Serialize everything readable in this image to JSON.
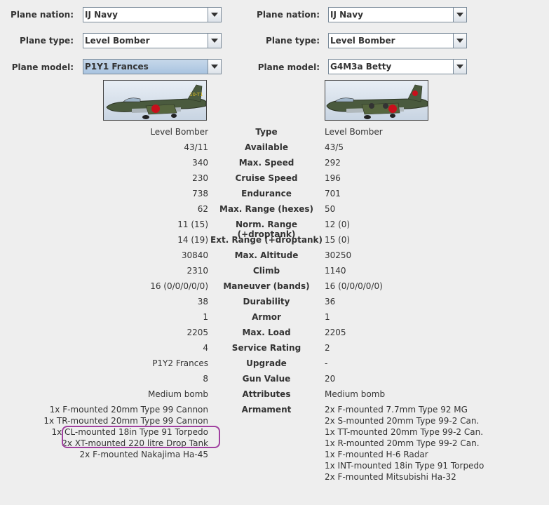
{
  "selectors": {
    "nation_label": "Plane nation:",
    "type_label": "Plane type:",
    "model_label": "Plane model:",
    "left": {
      "nation": "IJ Navy",
      "type": "Level Bomber",
      "model": "P1Y1 Frances"
    },
    "right": {
      "nation": "IJ Navy",
      "type": "Level Bomber",
      "model": "G4M3a Betty"
    }
  },
  "images": {
    "left": {
      "icon": "plane-p1y1-frances-image",
      "marking": "10-T1"
    },
    "right": {
      "icon": "plane-g4m3a-betty-image",
      "marking": ""
    }
  },
  "stats": [
    {
      "left": "Level Bomber",
      "label": "Type",
      "right": "Level Bomber"
    },
    {
      "left": "43/11",
      "label": "Available",
      "right": "43/5"
    },
    {
      "left": "340",
      "label": "Max. Speed",
      "right": "292"
    },
    {
      "left": "230",
      "label": "Cruise Speed",
      "right": "196"
    },
    {
      "left": "738",
      "label": "Endurance",
      "right": "701"
    },
    {
      "left": "62",
      "label": "Max. Range (hexes)",
      "right": "50"
    },
    {
      "left": "11 (15)",
      "label": "Norm. Range (+droptank)",
      "right": "12 (0)"
    },
    {
      "left": "14 (19)",
      "label": "Ext. Range (+droptank)",
      "right": "15 (0)"
    },
    {
      "left": "30840",
      "label": "Max. Altitude",
      "right": "30250"
    },
    {
      "left": "2310",
      "label": "Climb",
      "right": "1140"
    },
    {
      "left": "16 (0/0/0/0/0)",
      "label": "Maneuver (bands)",
      "right": "16 (0/0/0/0/0)"
    },
    {
      "left": "38",
      "label": "Durability",
      "right": "36"
    },
    {
      "left": "1",
      "label": "Armor",
      "right": "1"
    },
    {
      "left": "2205",
      "label": "Max. Load",
      "right": "2205"
    },
    {
      "left": "4",
      "label": "Service Rating",
      "right": "2"
    },
    {
      "left": "P1Y2 Frances",
      "label": "Upgrade",
      "right": "-"
    },
    {
      "left": "8",
      "label": "Gun Value",
      "right": "20"
    },
    {
      "left": "Medium bomb",
      "label": "Attributes",
      "right": "Medium bomb"
    }
  ],
  "armament": {
    "label": "Armament",
    "left": [
      "1x F-mounted 20mm Type 99 Cannon",
      "1x TR-mounted 20mm Type 99 Cannon",
      "1x CL-mounted 18in Type 91 Torpedo",
      "2x XT-mounted 220 litre Drop Tank",
      "2x F-mounted Nakajima Ha-45"
    ],
    "right": [
      "2x F-mounted 7.7mm Type 92 MG",
      "2x S-mounted 20mm Type 99-2 Can.",
      "1x TT-mounted 20mm Type 99-2 Can.",
      "1x R-mounted 20mm Type 99-2 Can.",
      "1x F-mounted H-6 Radar",
      "1x INT-mounted 18in Type 91 Torpedo",
      "2x F-mounted Mitsubishi Ha-32"
    ]
  },
  "colors": {
    "highlight_circle": "#a040a0",
    "selected_combo": "#b8cfe6",
    "background": "#eeeeee"
  }
}
